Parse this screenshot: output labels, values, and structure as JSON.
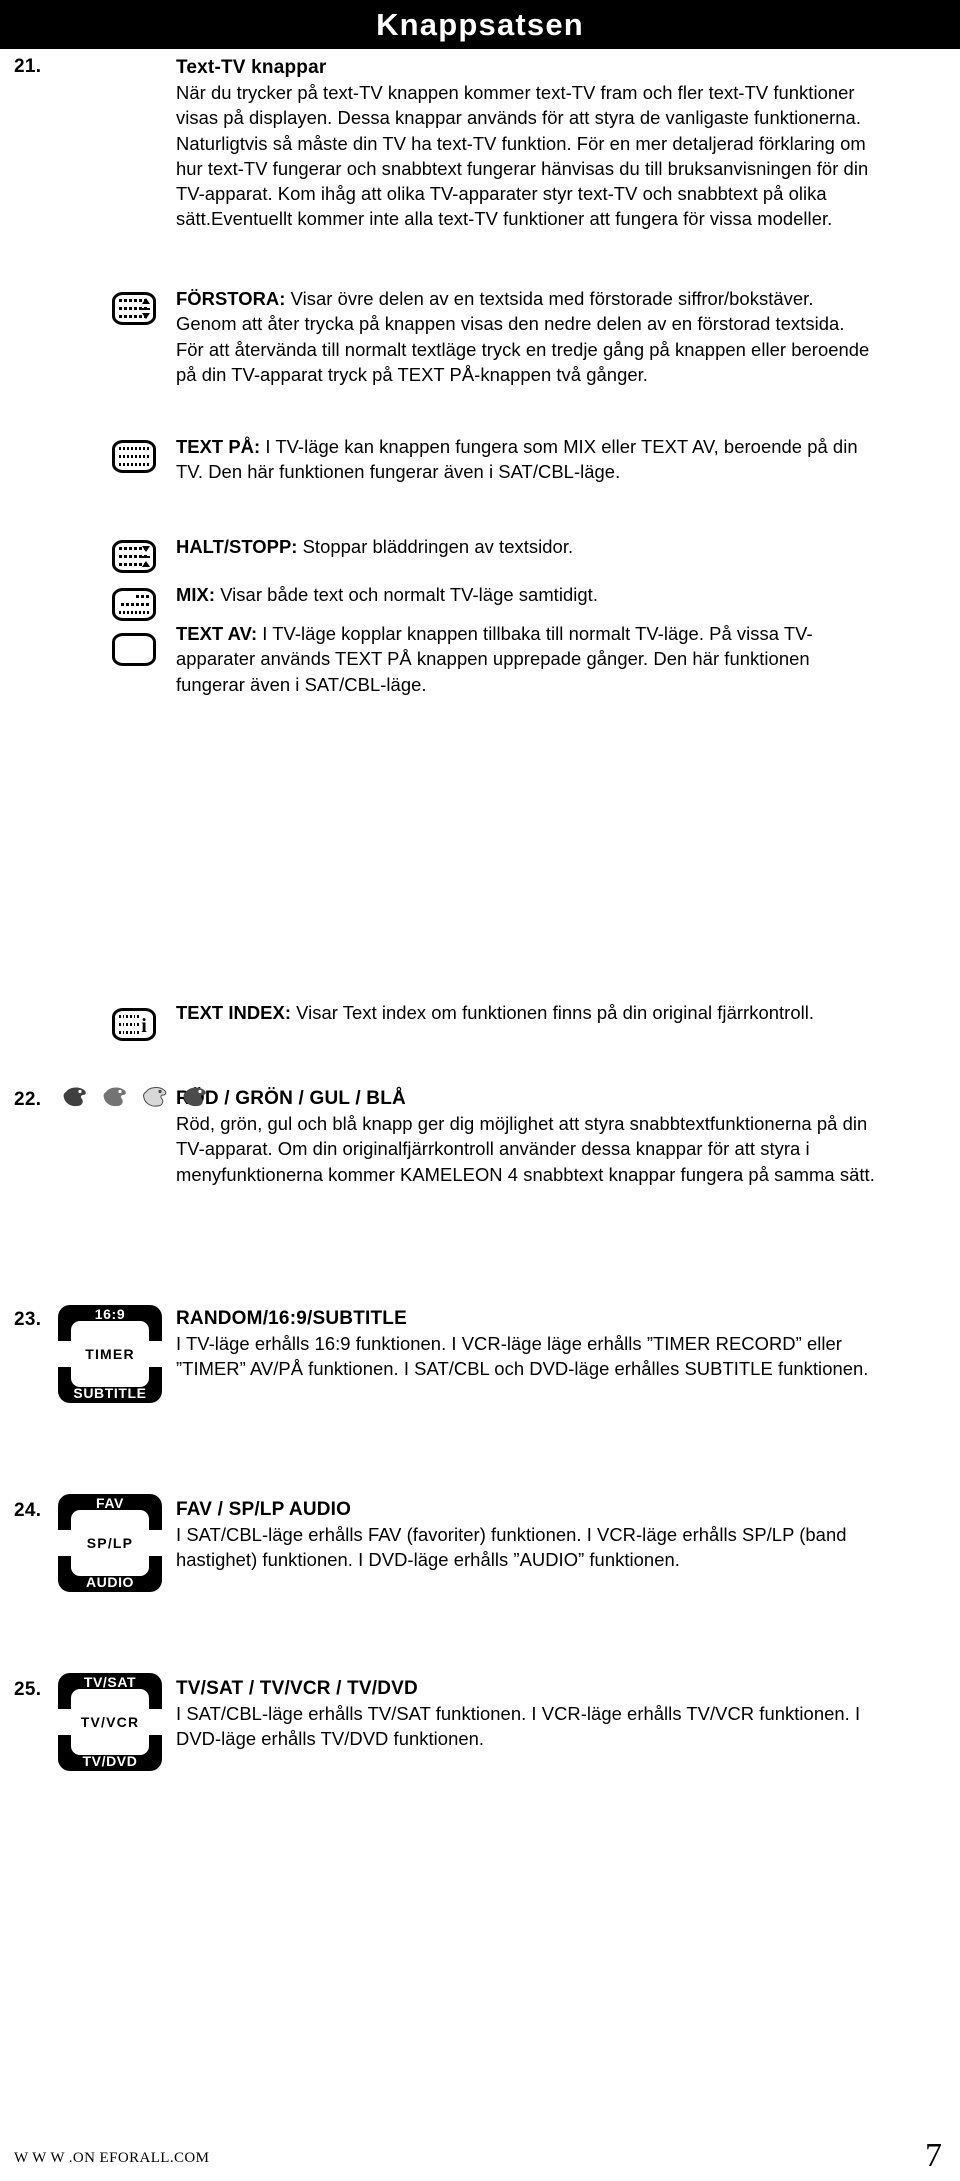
{
  "header": {
    "title": "Knappsatsen"
  },
  "entries": [
    {
      "number": "21.",
      "title": "Text-TV knappar",
      "text": "När du trycker på text-TV knappen kommer text-TV fram och fler text-TV funktioner visas på displayen. Dessa knappar används för att styra de vanligaste funktionerna. Naturligtvis så måste din TV ha text-TV funktion. För en mer detaljerad förklaring om hur text-TV fungerar och snabbtext fungerar hänvisas du till bruksanvisningen för din TV-apparat. Kom ihåg att olika TV-apparater styr text-TV och snabbtext på olika sätt.Eventuellt kommer inte alla text-TV funktioner att fungera för vissa modeller."
    },
    {
      "number": "22.",
      "title": "RÖD / GRÖN / GUL / BLÅ",
      "text": "Röd, grön, gul och blå knapp ger dig möjlighet att styra snabbtextfunktionerna på din TV-apparat. Om din originalfjärrkontroll använder dessa knappar för att styra i menyfunktionerna kommer KAMELEON 4 snabbtext knappar fungera på samma sätt."
    },
    {
      "number": "23.",
      "title": "RANDOM/16:9/SUBTITLE",
      "text": "I TV-läge erhålls 16:9 funktionen. I VCR-läge läge erhålls ”TIMER RECORD” eller ”TIMER” AV/PÅ funktionen. I SAT/CBL och DVD-läge erhålles SUBTITLE funktionen."
    },
    {
      "number": "24.",
      "title": "FAV / SP/LP AUDIO",
      "text": "I SAT/CBL-läge erhålls FAV (favoriter) funktionen. I VCR-läge erhålls SP/LP (band hastighet) funktionen. I DVD-läge erhålls ”AUDIO” funktionen."
    },
    {
      "number": "25.",
      "title": "TV/SAT / TV/VCR / TV/DVD",
      "text": "I SAT/CBL-läge erhålls TV/SAT funktionen. I VCR-läge erhålls TV/VCR funktionen. I DVD-läge erhålls TV/DVD funktionen."
    }
  ],
  "teletext_functions": [
    {
      "icon": "tv-screen-enlarge-icon",
      "label": "FÖRSTORA:",
      "text": " Visar övre delen av en textsida med förstorade siffror/bokstäver. Genom att åter trycka på knappen visas den nedre delen av en förstorad textsida. För att återvända till normalt textläge tryck en tredje gång på knappen eller beroende på din TV-apparat tryck på TEXT PÅ-knappen två gånger."
    },
    {
      "icon": "tv-screen-text-on-icon",
      "label": "TEXT PÅ:",
      "text": " I TV-läge kan knappen fungera som MIX eller TEXT AV, beroende på din TV. Den här funktionen fungerar även i SAT/CBL-läge."
    },
    {
      "icon": "tv-screen-hold-icon",
      "label": "HALT/STOPP:",
      "text": " Stoppar bläddringen av textsidor."
    },
    {
      "icon": "tv-screen-mix-icon",
      "label": "MIX:",
      "text": " Visar både text och normalt TV-läge samtidigt."
    },
    {
      "icon": "tv-screen-text-off-icon",
      "label": "TEXT AV:",
      "text": " I TV-läge kopplar knappen tillbaka till normalt TV-läge. På vissa TV-apparater används TEXT PÅ knappen upprepade gånger. Den här funktionen fungerar även i SAT/CBL-läge."
    },
    {
      "icon": "tv-screen-index-icon",
      "label": "TEXT INDEX:",
      "text": " Visar Text index om funktionen finns på din original fjärrkontroll."
    }
  ],
  "color_keys": [
    {
      "name": "red-key-icon",
      "color": "#3a3a3a"
    },
    {
      "name": "green-key-icon",
      "color": "#6e6e6e"
    },
    {
      "name": "yellow-key-icon",
      "color": "#d0d0d0"
    },
    {
      "name": "blue-key-icon",
      "color": "#4a4a4a"
    }
  ],
  "remote_keys": {
    "item23": {
      "top": "16:9",
      "mid": "TIMER",
      "bottom": "SUBTITLE"
    },
    "item24": {
      "top": "FAV",
      "mid": "SP/LP",
      "bottom": "AUDIO"
    },
    "item25": {
      "top": "TV/SAT",
      "mid": "TV/VCR",
      "bottom": "TV/DVD"
    }
  },
  "footer": {
    "url": "W W W .ON EFORALL.COM",
    "page": "7"
  }
}
